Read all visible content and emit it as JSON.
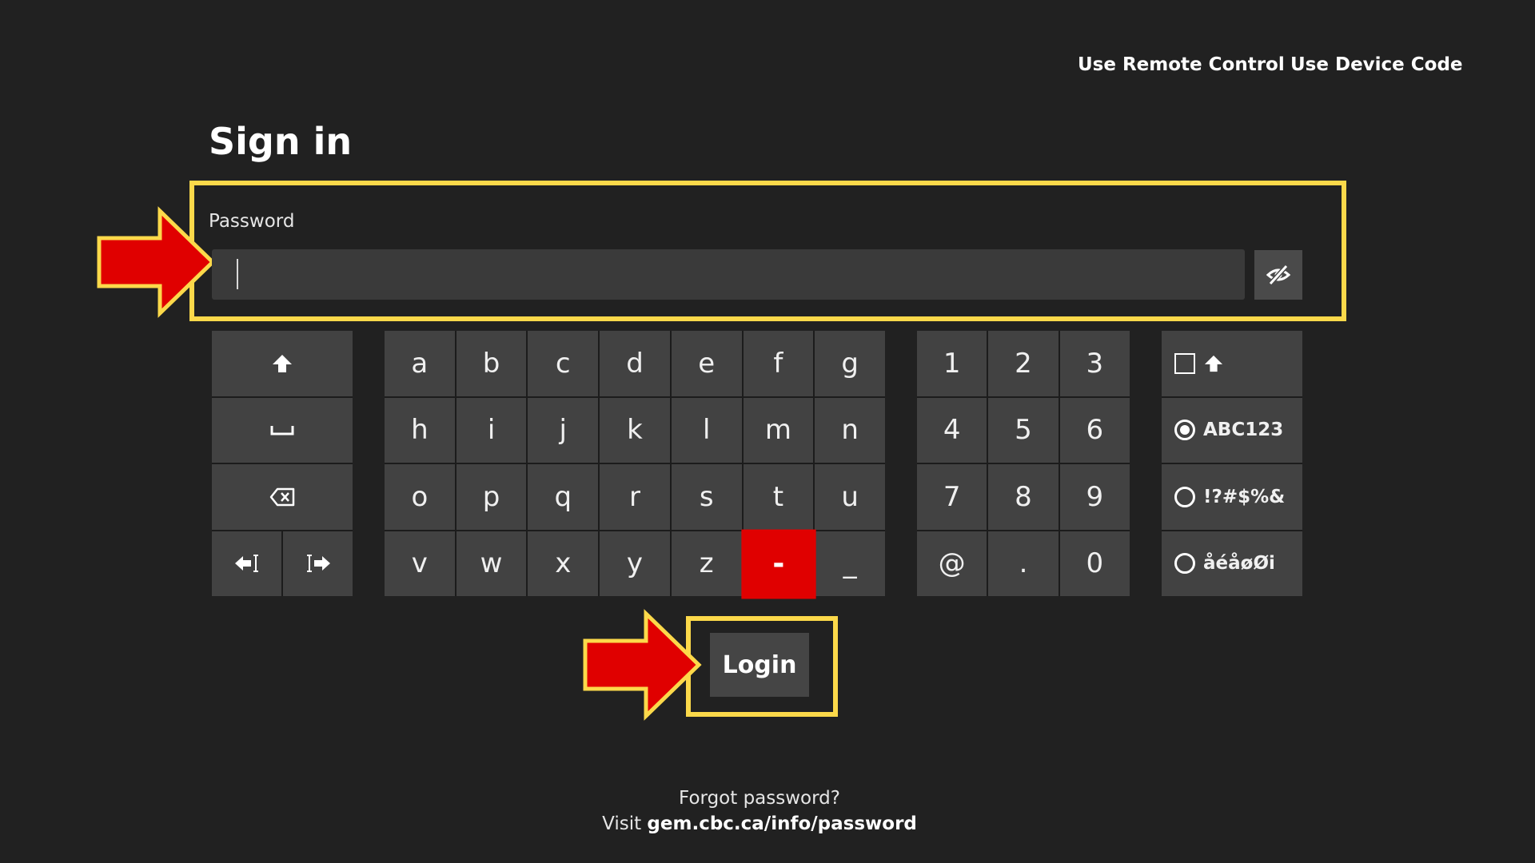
{
  "header": {
    "remote_control_link": "Use Remote Control",
    "device_code_link": "Use Device Code"
  },
  "title": "Sign in",
  "password_field": {
    "label": "Password",
    "value": "",
    "toggle_icon": "eye-slash-icon"
  },
  "keyboard": {
    "control_keys": {
      "shift_icon": "up-arrow-icon",
      "space_icon": "space-bar-icon",
      "backspace_icon": "backspace-icon",
      "cursor_left_icon": "cursor-left-icon",
      "cursor_right_icon": "cursor-right-icon"
    },
    "letter_rows": [
      [
        "a",
        "b",
        "c",
        "d",
        "e",
        "f",
        "g"
      ],
      [
        "h",
        "i",
        "j",
        "k",
        "l",
        "m",
        "n"
      ],
      [
        "o",
        "p",
        "q",
        "r",
        "s",
        "t",
        "u"
      ],
      [
        "v",
        "w",
        "x",
        "y",
        "z",
        "-",
        "_"
      ]
    ],
    "number_rows": [
      [
        "1",
        "2",
        "3"
      ],
      [
        "4",
        "5",
        "6"
      ],
      [
        "7",
        "8",
        "9"
      ],
      [
        "@",
        ".",
        "0"
      ]
    ],
    "active_key": "-",
    "active_color": "#e00000",
    "modes": {
      "caps_lock_icon": "checkbox-shift-icon",
      "abc123": "ABC123",
      "symbols": "!?#$%&",
      "accents": "åéåøØi",
      "selected": "ABC123"
    }
  },
  "login_button": "Login",
  "footer": {
    "forgot_text": "Forgot password?",
    "visit_text": "Visit",
    "visit_link": "gem.cbc.ca/info/password"
  },
  "annotation": {
    "highlight_color": "#fcd94a",
    "arrow_color": "#e00000"
  }
}
